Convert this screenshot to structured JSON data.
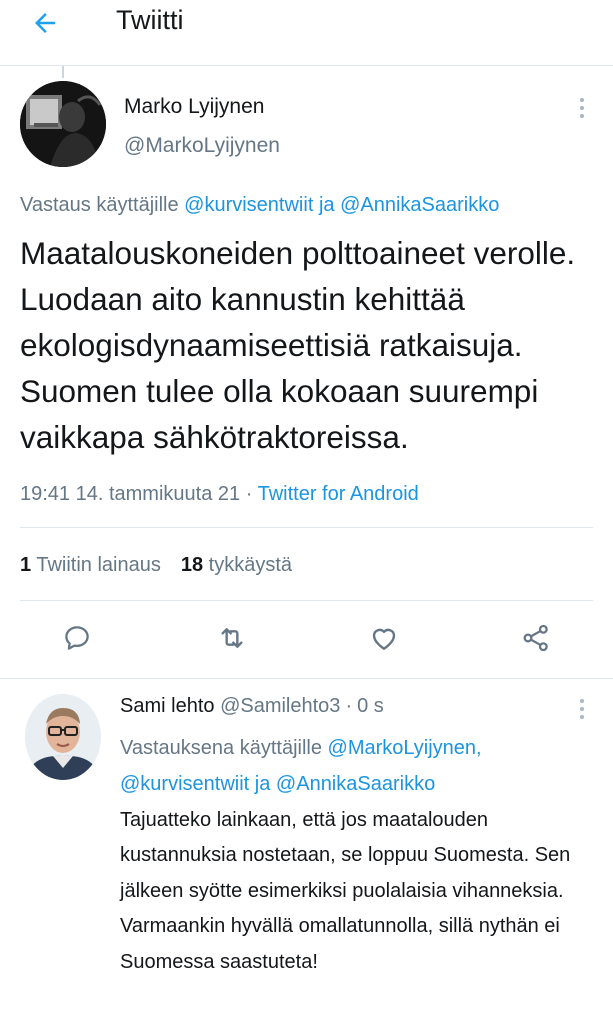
{
  "header": {
    "title": "Twiitti",
    "back_icon": "arrow-left-icon"
  },
  "main_tweet": {
    "author_name": "Marko Lyijynen",
    "author_handle": "@MarkoLyijynen",
    "reply_prefix": "Vastaus käyttäjille",
    "reply_user_1": "@kurvisentwiit",
    "reply_and": "ja",
    "reply_user_2": "@AnnikaSaarikko",
    "text": "Maatalouskoneiden polttoaineet verolle. Luodaan aito kannustin kehittää ekologisdynaamiseettisiä ratkaisuja. Suomen tulee olla kokoaan suurempi vaikkapa sähkötraktoreissa.",
    "timestamp": "19:41 14. tammikuuta 21",
    "separator": "·",
    "source": "Twitter for Android",
    "quote_count": "1",
    "quote_label": "Twiitin lainaus",
    "like_count": "18",
    "like_label": "tykkäystä"
  },
  "actions": [
    {
      "icon": "reply-icon"
    },
    {
      "icon": "retweet-icon"
    },
    {
      "icon": "like-icon"
    },
    {
      "icon": "share-icon"
    }
  ],
  "reply_tweet": {
    "author_name": "Sami lehto",
    "author_handle": "@Samilehto3",
    "separator": "·",
    "time": "0 s",
    "reply_prefix": "Vastauksena käyttäjille",
    "reply_user_1": "@MarkoLyijynen,",
    "reply_user_2": "@kurvisentwiit",
    "reply_and": "ja",
    "reply_user_3": "@AnnikaSaarikko",
    "text": "Tajuatteko lainkaan, että jos maatalouden kustannuksia nostetaan, se loppuu Suomesta. Sen jälkeen syötte esimerkiksi puolalaisia vihanneksia. Varmaankin hyvällä omallatunnolla, sillä nythän ei Suomessa saastuteta!"
  },
  "colors": {
    "accent": "#1da1f2",
    "link": "#1b95e0",
    "secondary_text": "#657786",
    "primary_text": "#14171a",
    "divider": "#e1e8ed"
  }
}
